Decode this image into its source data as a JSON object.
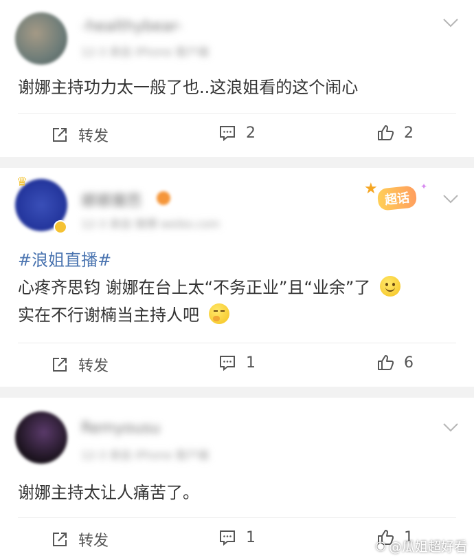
{
  "posts": [
    {
      "username": "-healthybear-",
      "meta": "12-3 来自 iPhone 客户端",
      "content": "谢娜主持功力太一般了也..这浪姐看的这个闹心",
      "repost_label": "转发",
      "comments": "2",
      "likes": "2"
    },
    {
      "username": "娜娜魔芭",
      "meta": "12-3 来自 微博 weibo.com",
      "badge_text": "超话",
      "hashtag": "#浪姐直播#",
      "line1": "心疼齐思钧 谢娜在台上太“不务正业”且“业余”了",
      "line2": "实在不行谢楠当主持人吧",
      "repost_label": "转发",
      "comments": "1",
      "likes": "6"
    },
    {
      "username": "Remyousu",
      "meta": "12-3 来自 iPhone 客户端",
      "content": "谢娜主持太让人痛苦了。",
      "repost_label": "转发",
      "comments": "1",
      "likes": "1"
    }
  ],
  "watermark": "@瓜姐超好看"
}
